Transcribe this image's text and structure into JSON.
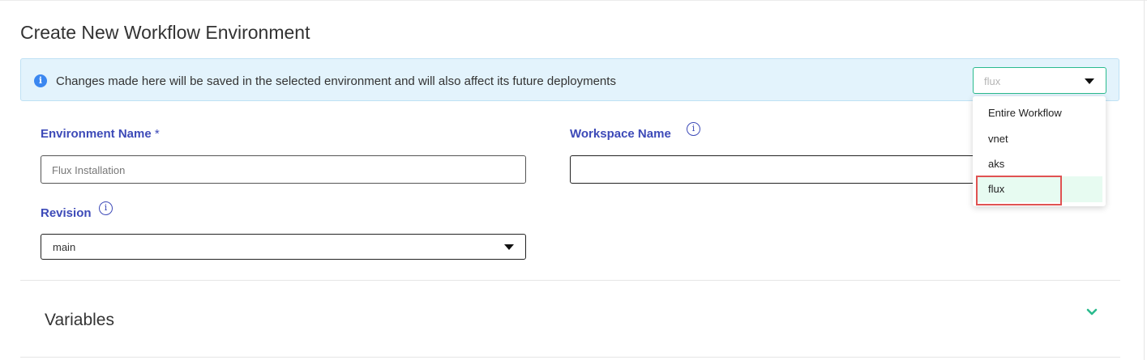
{
  "page": {
    "title": "Create New Workflow Environment"
  },
  "banner": {
    "message": "Changes made here will be saved in the selected environment and will also affect its future deployments",
    "icon": "info-icon",
    "environment_select": {
      "value": "flux",
      "options": [
        "Entire Workflow",
        "vnet",
        "aks",
        "flux"
      ],
      "selected": "flux"
    }
  },
  "form": {
    "environment_name": {
      "label": "Environment Name",
      "required_mark": "*",
      "placeholder": "Flux Installation"
    },
    "workspace_name": {
      "label": "Workspace Name",
      "value": ""
    },
    "revision": {
      "label": "Revision",
      "value": "main"
    }
  },
  "sections": {
    "variables": {
      "label": "Variables",
      "icon": "chevron-down-icon"
    }
  },
  "colors": {
    "label": "#3d4ab8",
    "accent": "#2bbb8e",
    "banner_bg": "#e3f3fc",
    "info": "#3b87f0",
    "highlight": "#e05252"
  }
}
